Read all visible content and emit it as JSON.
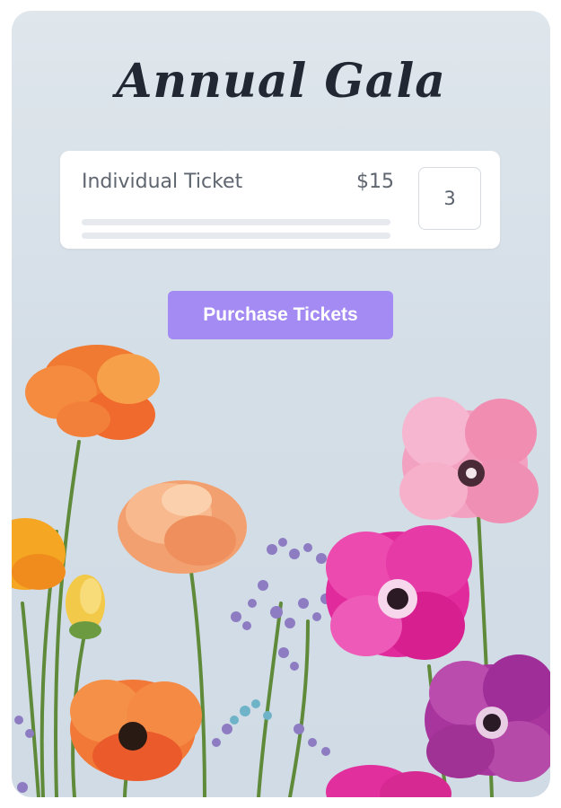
{
  "event": {
    "title": "Annual Gala"
  },
  "ticket": {
    "name": "Individual Ticket",
    "price": "$15",
    "quantity": "3"
  },
  "actions": {
    "purchase_label": "Purchase Tickets"
  },
  "colors": {
    "background": "#d4dee7",
    "accent_button": "#a48bf3",
    "title_text": "#222833"
  },
  "image": {
    "description": "flower-arrangement-photo"
  }
}
